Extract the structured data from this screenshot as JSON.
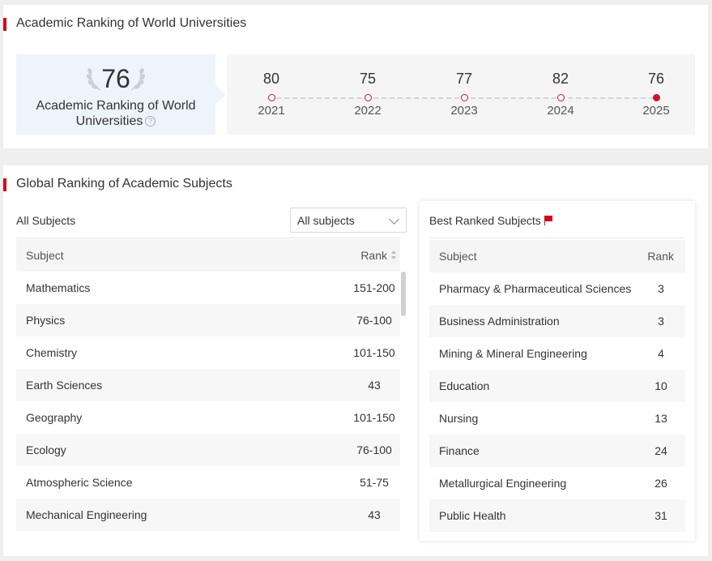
{
  "arwu": {
    "title": "Academic Ranking of World Universities",
    "current_rank": "76",
    "label": "Academic Ranking of World Universities",
    "help_glyph": "?",
    "history": [
      {
        "rank": "80",
        "year": "2021"
      },
      {
        "rank": "75",
        "year": "2022"
      },
      {
        "rank": "77",
        "year": "2023"
      },
      {
        "rank": "82",
        "year": "2024"
      },
      {
        "rank": "76",
        "year": "2025"
      }
    ]
  },
  "gras": {
    "title": "Global Ranking of Academic Subjects",
    "all_subjects_label": "All Subjects",
    "filter": {
      "selected": "All subjects"
    },
    "table_headers": {
      "subject": "Subject",
      "rank": "Rank"
    },
    "subjects": [
      {
        "subject": "Mathematics",
        "rank": "151-200"
      },
      {
        "subject": "Physics",
        "rank": "76-100"
      },
      {
        "subject": "Chemistry",
        "rank": "101-150"
      },
      {
        "subject": "Earth Sciences",
        "rank": "43"
      },
      {
        "subject": "Geography",
        "rank": "101-150"
      },
      {
        "subject": "Ecology",
        "rank": "76-100"
      },
      {
        "subject": "Atmospheric Science",
        "rank": "51-75"
      },
      {
        "subject": "Mechanical Engineering",
        "rank": "43"
      }
    ],
    "best": {
      "title": "Best Ranked Subjects",
      "headers": {
        "subject": "Subject",
        "rank": "Rank"
      },
      "items": [
        {
          "subject": "Pharmacy & Pharmaceutical Sciences",
          "rank": "3"
        },
        {
          "subject": "Business Administration",
          "rank": "3"
        },
        {
          "subject": "Mining & Mineral Engineering",
          "rank": "4"
        },
        {
          "subject": "Education",
          "rank": "10"
        },
        {
          "subject": "Nursing",
          "rank": "13"
        },
        {
          "subject": "Finance",
          "rank": "24"
        },
        {
          "subject": "Metallurgical Engineering",
          "rank": "26"
        },
        {
          "subject": "Public Health",
          "rank": "31"
        }
      ]
    }
  },
  "colors": {
    "accent": "#d6001c",
    "rank_box_bg": "#eef4fb"
  }
}
